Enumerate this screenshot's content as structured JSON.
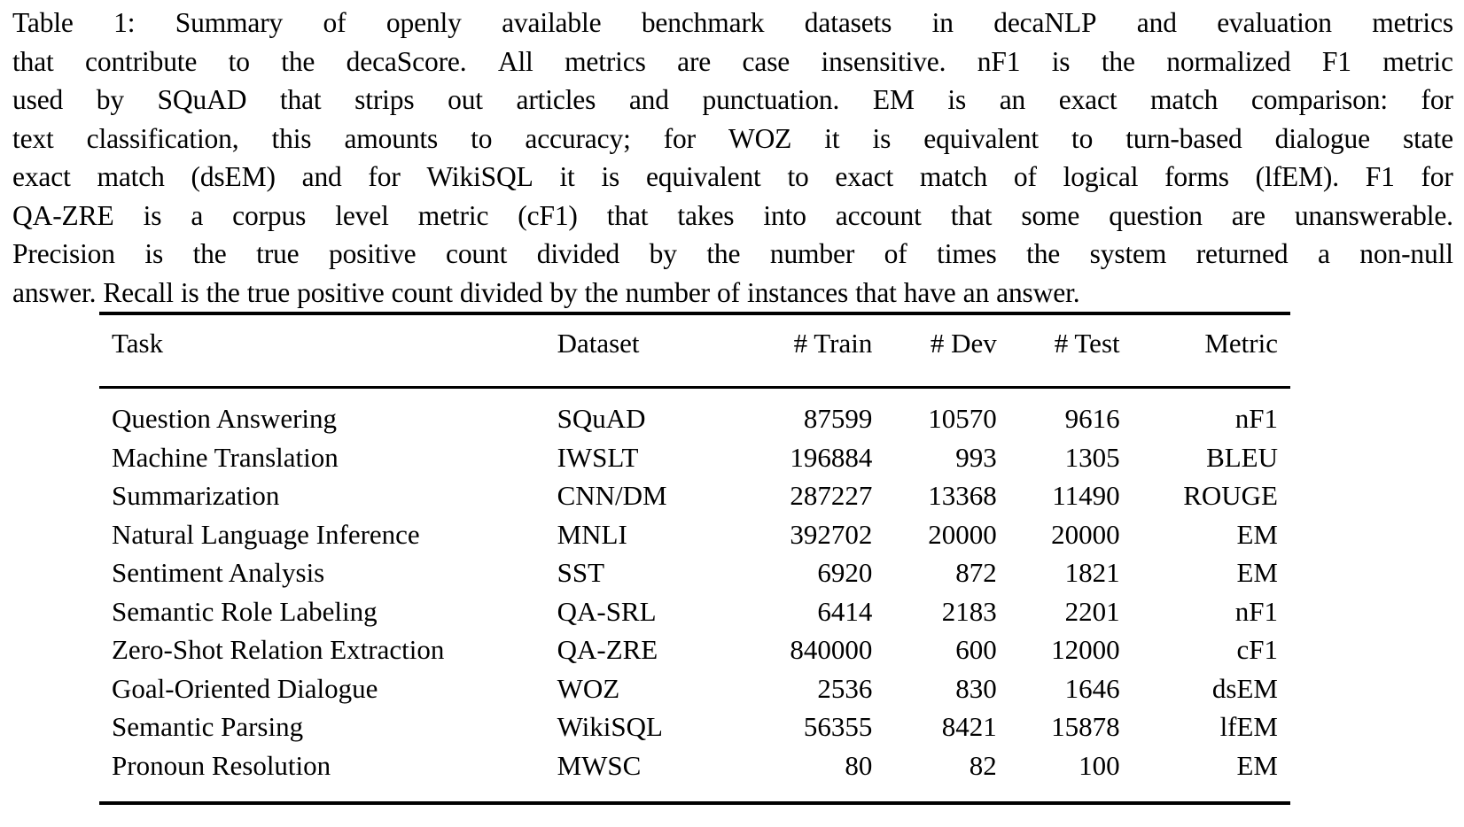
{
  "caption": {
    "label": "Table 1:",
    "full_text": "Table 1:  Summary of openly available benchmark datasets in decaNLP and evaluation metrics that contribute to the decaScore. All metrics are case insensitive. nF1 is the normalized F1 metric used by SQuAD that strips out articles and punctuation.  EM is an exact match comparison:  for text classification, this amounts to accuracy; for WOZ it is equivalent to turn-based dialogue state exact match (dsEM) and for WikiSQL it is equivalent to exact match of logical forms (lfEM). F1 for QA-ZRE is a corpus level metric (cF1) that takes into account that some question are unanswerable. Precision is the true positive count divided by the number of times the system returned a non-null answer. Recall is the true positive count divided by the number of instances that have an answer.",
    "lines": [
      "Table 1:   Summary of openly available benchmark datasets in decaNLP and evaluation metrics",
      "that contribute to the decaScore. All metrics are case insensitive. nF1 is the normalized F1 metric",
      "used by SQuAD that strips out articles and punctuation.  EM is an exact match comparison:  for",
      "text classification, this amounts to accuracy; for WOZ it is equivalent to turn-based dialogue state",
      "exact match (dsEM) and for WikiSQL it is equivalent to exact match of logical forms (lfEM). F1 for",
      "QA-ZRE is a corpus level metric (cF1) that takes into account that some question are unanswerable.",
      "Precision is the true positive count divided by the number of times the system returned a non-null",
      "answer. Recall is the true positive count divided by the number of instances that have an answer."
    ]
  },
  "chart_data": {
    "type": "table",
    "title": "Summary of openly available benchmark datasets in decaNLP and evaluation metrics",
    "columns": [
      "Task",
      "Dataset",
      "# Train",
      "# Dev",
      "# Test",
      "Metric"
    ],
    "column_align": [
      "left",
      "left",
      "right",
      "right",
      "right",
      "right"
    ],
    "rows": [
      [
        "Question Answering",
        "SQuAD",
        "87599",
        "10570",
        "9616",
        "nF1"
      ],
      [
        "Machine Translation",
        "IWSLT",
        "196884",
        "993",
        "1305",
        "BLEU"
      ],
      [
        "Summarization",
        "CNN/DM",
        "287227",
        "13368",
        "11490",
        "ROUGE"
      ],
      [
        "Natural Language Inference",
        "MNLI",
        "392702",
        "20000",
        "20000",
        "EM"
      ],
      [
        "Sentiment Analysis",
        "SST",
        "6920",
        "872",
        "1821",
        "EM"
      ],
      [
        "Semantic Role Labeling",
        "QA-SRL",
        "6414",
        "2183",
        "2201",
        "nF1"
      ],
      [
        "Zero-Shot Relation Extraction",
        "QA-ZRE",
        "840000",
        "600",
        "12000",
        "cF1"
      ],
      [
        "Goal-Oriented Dialogue",
        "WOZ",
        "2536",
        "830",
        "1646",
        "dsEM"
      ],
      [
        "Semantic Parsing",
        "WikiSQL",
        "56355",
        "8421",
        "15878",
        "lfEM"
      ],
      [
        "Pronoun Resolution",
        "MWSC",
        "80",
        "82",
        "100",
        "EM"
      ]
    ],
    "numeric_columns": {
      "train": [
        87599,
        196884,
        287227,
        392702,
        6920,
        6414,
        840000,
        2536,
        56355,
        80
      ],
      "dev": [
        10570,
        993,
        13368,
        20000,
        872,
        2183,
        600,
        830,
        8421,
        82
      ],
      "test": [
        9616,
        1305,
        11490,
        20000,
        1821,
        2201,
        12000,
        1646,
        15878,
        100
      ]
    },
    "grid": false,
    "legend": "none"
  },
  "colors": {
    "text": "#000000",
    "background": "#ffffff",
    "rule": "#000000"
  }
}
